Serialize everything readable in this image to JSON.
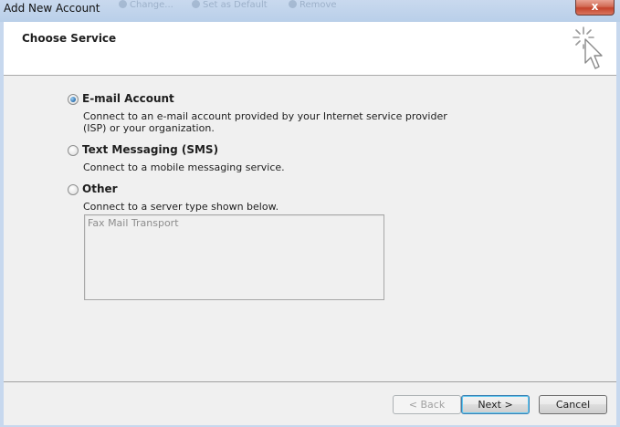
{
  "window": {
    "title": "Add New Account",
    "close_glyph": "x",
    "background_toolbar": [
      "Change...",
      "Set as Default",
      "Remove"
    ]
  },
  "header": {
    "heading": "Choose Service",
    "icon": "wizard-cursor-icon"
  },
  "options": [
    {
      "label": "E-mail Account",
      "description": "Connect to an e-mail account provided by your Internet service provider (ISP) or your organization.",
      "selected": true
    },
    {
      "label": "Text Messaging (SMS)",
      "description": "Connect to a mobile messaging service.",
      "selected": false
    },
    {
      "label": "Other",
      "description": "Connect to a server type shown below.",
      "selected": false
    }
  ],
  "server_types": [
    "Fax Mail Transport"
  ],
  "buttons": {
    "back": "< Back",
    "next": "Next >",
    "cancel": "Cancel"
  },
  "colors": {
    "titlebar": "#c5d7ee",
    "close_button": "#c4432b",
    "dialog_bg": "#f0f0f0",
    "header_bg": "#ffffff",
    "default_button_border": "#3c7fb1"
  }
}
